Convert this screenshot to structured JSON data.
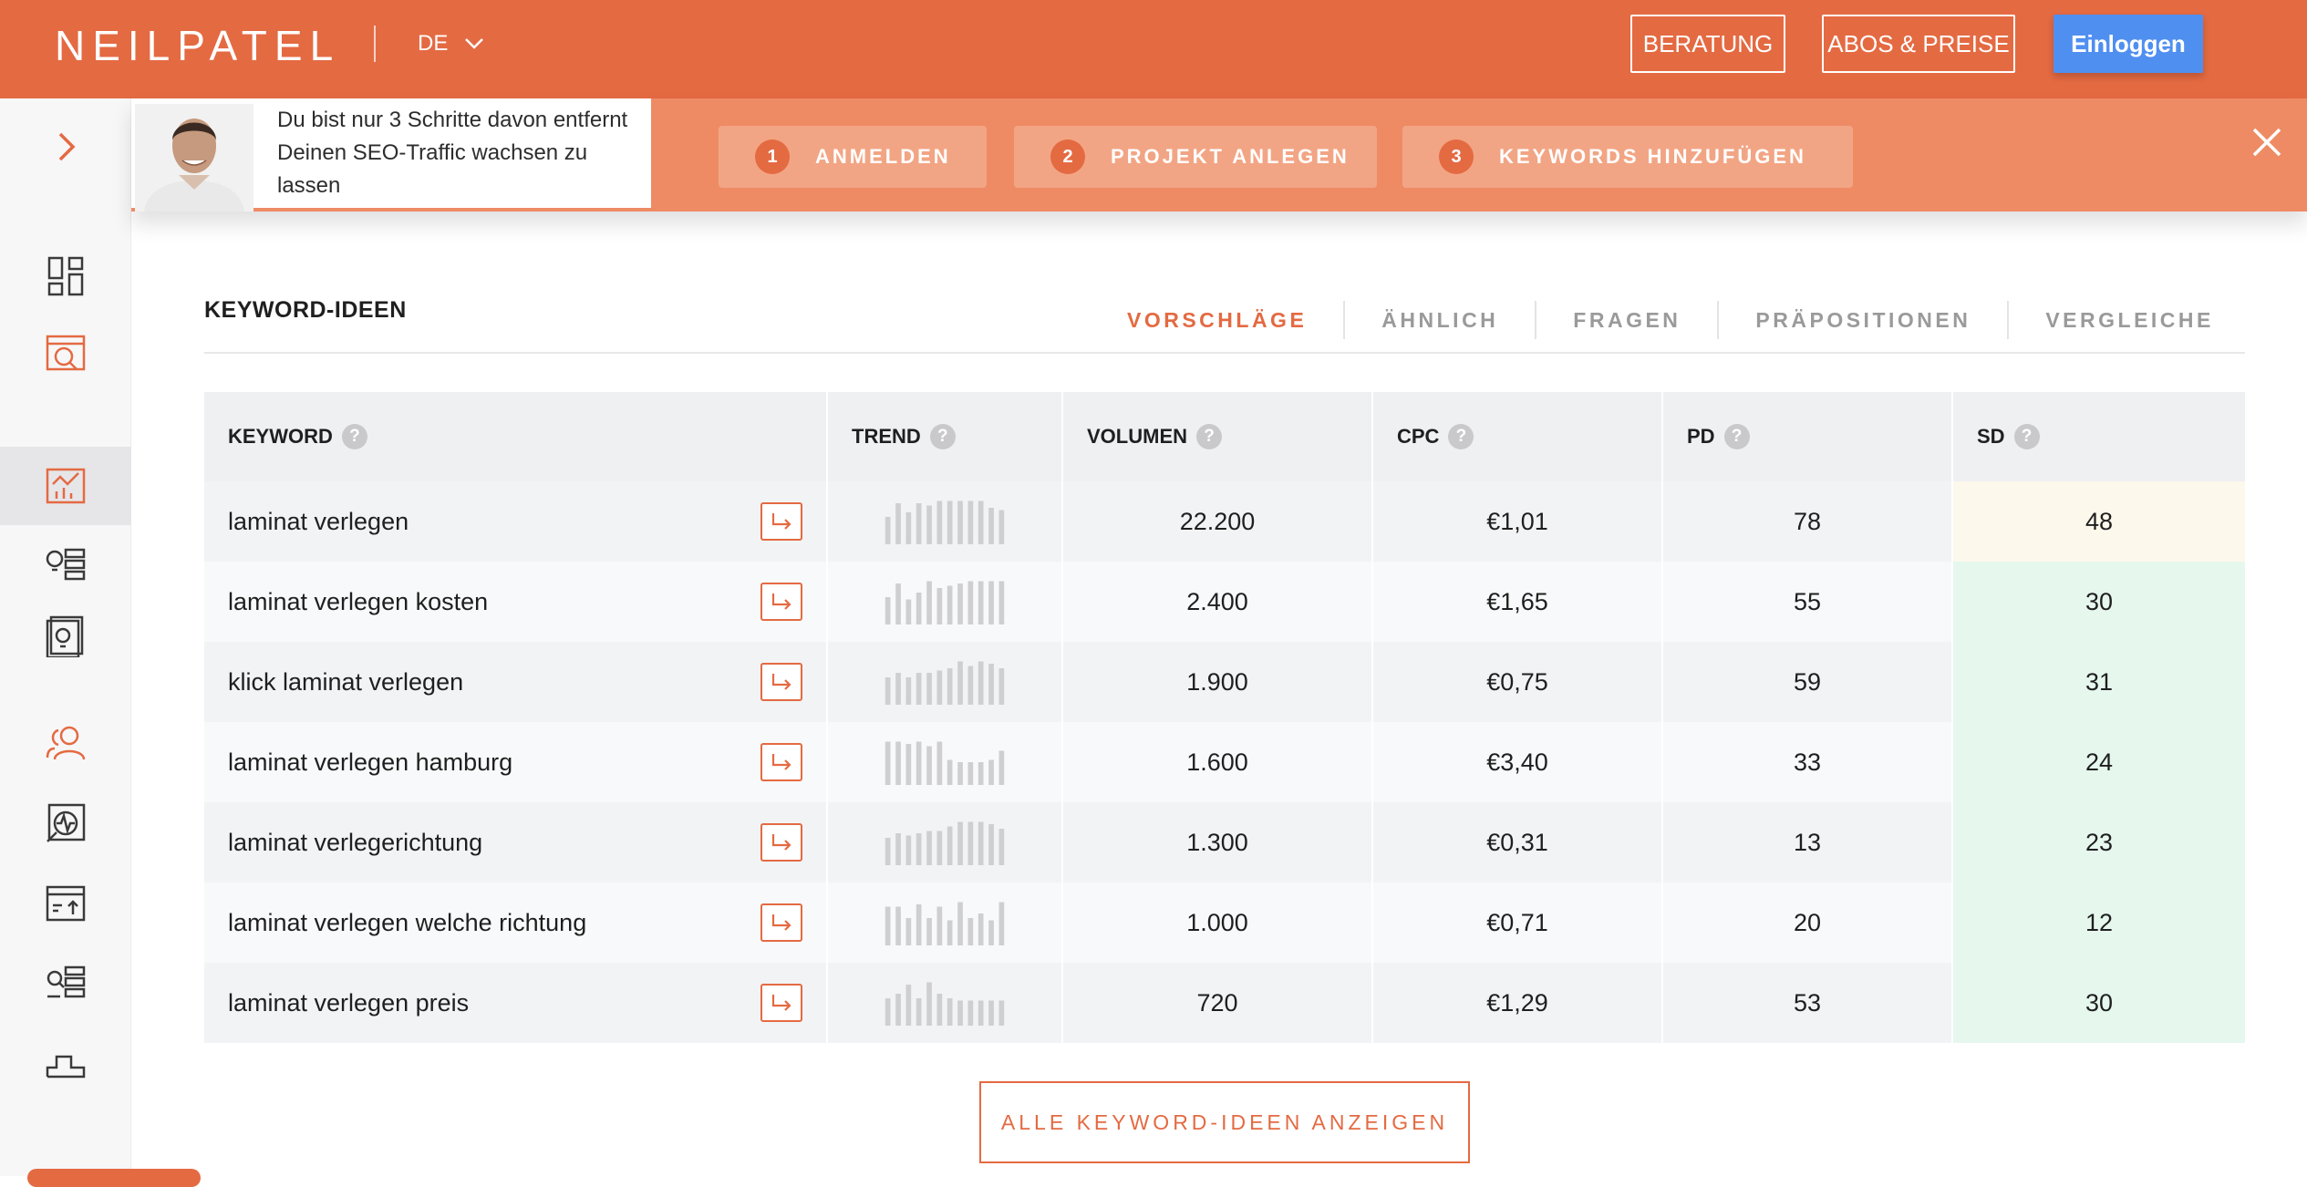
{
  "header": {
    "logo": "NEILPATEL",
    "language": "DE",
    "beratung_label": "BERATUNG",
    "abos_label": "ABOS & PREISE",
    "login_label": "Einloggen"
  },
  "onboarding": {
    "message": "Du bist nur 3 Schritte davon entfernt Deinen SEO-Traffic wachsen zu lassen",
    "steps": [
      {
        "num": "1",
        "label": "ANMELDEN"
      },
      {
        "num": "2",
        "label": "PROJEKT ANLEGEN"
      },
      {
        "num": "3",
        "label": "KEYWORDS HINZUFÜGEN"
      }
    ]
  },
  "section": {
    "title": "KEYWORD-IDEEN",
    "tabs": [
      "VORSCHLÄGE",
      "ÄHNLICH",
      "FRAGEN",
      "PRÄPOSITIONEN",
      "VERGLEICHE"
    ],
    "active_tab": "VORSCHLÄGE"
  },
  "table": {
    "headers": {
      "keyword": "KEYWORD",
      "trend": "TREND",
      "volume": "VOLUMEN",
      "cpc": "CPC",
      "pd": "PD",
      "sd": "SD"
    },
    "help_symbol": "?",
    "rows": [
      {
        "keyword": "laminat verlegen",
        "volume": "22.200",
        "cpc": "€1,01",
        "pd": "78",
        "sd": "48",
        "sd_level": "yellow",
        "trend": [
          0.6,
          0.9,
          0.7,
          0.9,
          0.85,
          0.95,
          0.95,
          0.95,
          0.95,
          0.95,
          0.8,
          0.75
        ]
      },
      {
        "keyword": "laminat verlegen kosten",
        "volume": "2.400",
        "cpc": "€1,65",
        "pd": "55",
        "sd": "30",
        "sd_level": "green",
        "trend": [
          0.6,
          0.9,
          0.55,
          0.7,
          0.95,
          0.8,
          0.85,
          0.9,
          0.95,
          0.95,
          0.95,
          0.95
        ]
      },
      {
        "keyword": "klick laminat verlegen",
        "volume": "1.900",
        "cpc": "€0,75",
        "pd": "59",
        "sd": "31",
        "sd_level": "green",
        "trend": [
          0.6,
          0.7,
          0.6,
          0.7,
          0.7,
          0.75,
          0.8,
          0.95,
          0.85,
          0.95,
          0.9,
          0.8
        ]
      },
      {
        "keyword": "laminat verlegen hamburg",
        "volume": "1.600",
        "cpc": "€3,40",
        "pd": "33",
        "sd": "24",
        "sd_level": "green",
        "trend": [
          0.95,
          0.95,
          0.9,
          0.95,
          0.85,
          0.95,
          0.55,
          0.5,
          0.5,
          0.5,
          0.55,
          0.75
        ]
      },
      {
        "keyword": "laminat verlegerichtung",
        "volume": "1.300",
        "cpc": "€0,31",
        "pd": "13",
        "sd": "23",
        "sd_level": "green",
        "trend": [
          0.6,
          0.7,
          0.65,
          0.7,
          0.75,
          0.75,
          0.85,
          0.95,
          0.95,
          0.95,
          0.9,
          0.8
        ]
      },
      {
        "keyword": "laminat verlegen welche richtung",
        "volume": "1.000",
        "cpc": "€0,71",
        "pd": "20",
        "sd": "12",
        "sd_level": "green",
        "trend": [
          0.85,
          0.85,
          0.6,
          0.9,
          0.6,
          0.85,
          0.55,
          0.95,
          0.6,
          0.7,
          0.55,
          0.95
        ]
      },
      {
        "keyword": "laminat verlegen preis",
        "volume": "720",
        "cpc": "€1,29",
        "pd": "53",
        "sd": "30",
        "sd_level": "green",
        "trend": [
          0.6,
          0.7,
          0.9,
          0.6,
          0.95,
          0.7,
          0.6,
          0.55,
          0.55,
          0.55,
          0.55,
          0.55
        ]
      }
    ]
  },
  "show_all_label": "ALLE KEYWORD-IDEEN ANZEIGEN",
  "colors": {
    "accent": "#e46a42",
    "login": "#4f8ff0",
    "sd_yellow": "#fdf8ec",
    "sd_green": "#e6f7ee"
  }
}
